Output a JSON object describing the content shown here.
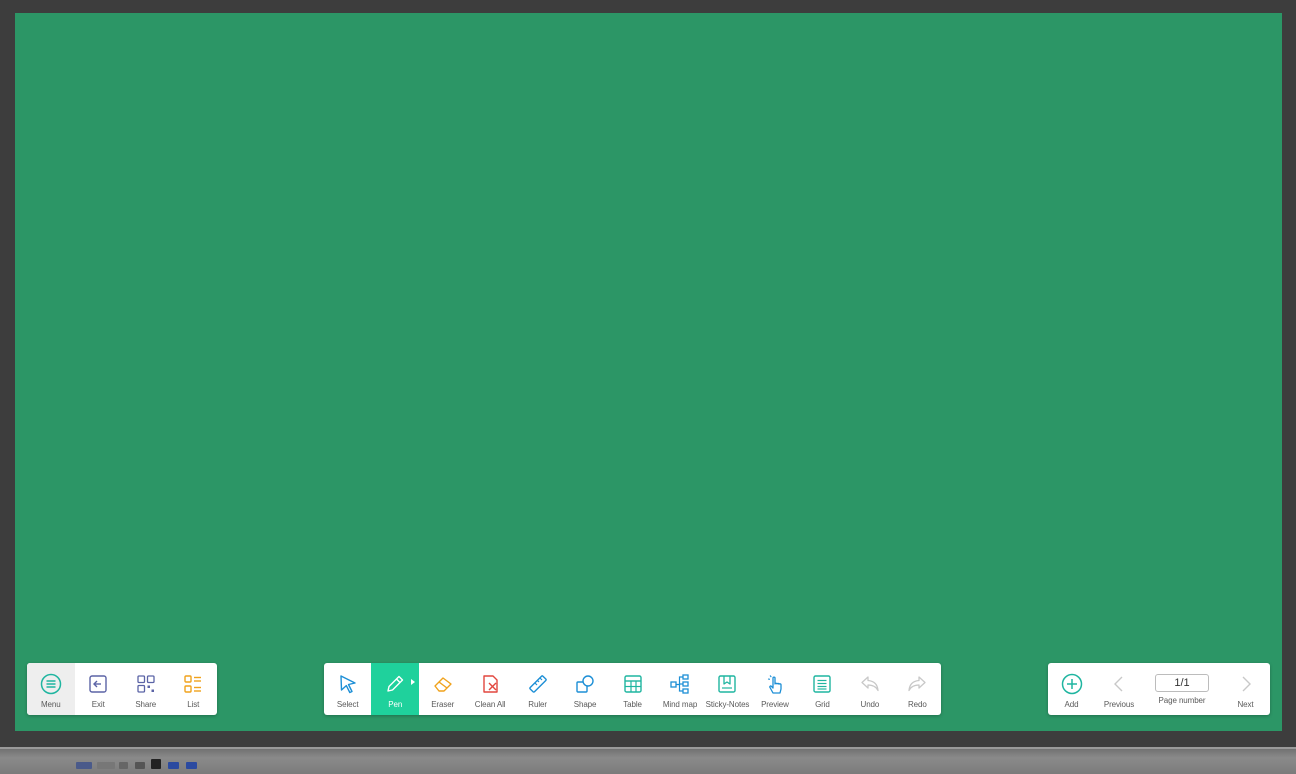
{
  "left_toolbar": {
    "items": [
      {
        "label": "Menu",
        "icon": "menu-icon"
      },
      {
        "label": "Exit",
        "icon": "exit-icon"
      },
      {
        "label": "Share",
        "icon": "share-icon"
      },
      {
        "label": "List",
        "icon": "list-icon"
      }
    ]
  },
  "main_toolbar": {
    "items": [
      {
        "label": "Select",
        "icon": "cursor-icon"
      },
      {
        "label": "Pen",
        "icon": "pen-icon"
      },
      {
        "label": "Eraser",
        "icon": "eraser-icon"
      },
      {
        "label": "Clean All",
        "icon": "clean-all-icon"
      },
      {
        "label": "Ruler",
        "icon": "ruler-icon"
      },
      {
        "label": "Shape",
        "icon": "shape-icon"
      },
      {
        "label": "Table",
        "icon": "table-icon"
      },
      {
        "label": "Mind map",
        "icon": "mind-map-icon"
      },
      {
        "label": "Sticky-Notes",
        "icon": "sticky-notes-icon"
      },
      {
        "label": "Preview",
        "icon": "hand-pointer-icon"
      },
      {
        "label": "Grid",
        "icon": "grid-icon"
      },
      {
        "label": "Undo",
        "icon": "undo-icon"
      },
      {
        "label": "Redo",
        "icon": "redo-icon"
      }
    ]
  },
  "page_toolbar": {
    "add_label": "Add",
    "previous_label": "Previous",
    "page_label": "Page number",
    "page_value": "1/1",
    "next_label": "Next"
  },
  "colors": {
    "board": "#2c9666",
    "accent": "#1fd19c",
    "icon_teal": "#1fb5a0",
    "icon_blue": "#1d8fd6",
    "icon_orange": "#f0a21c",
    "icon_red": "#e2473f",
    "icon_purple": "#5b63a6",
    "disabled": "#c8c8c8"
  }
}
